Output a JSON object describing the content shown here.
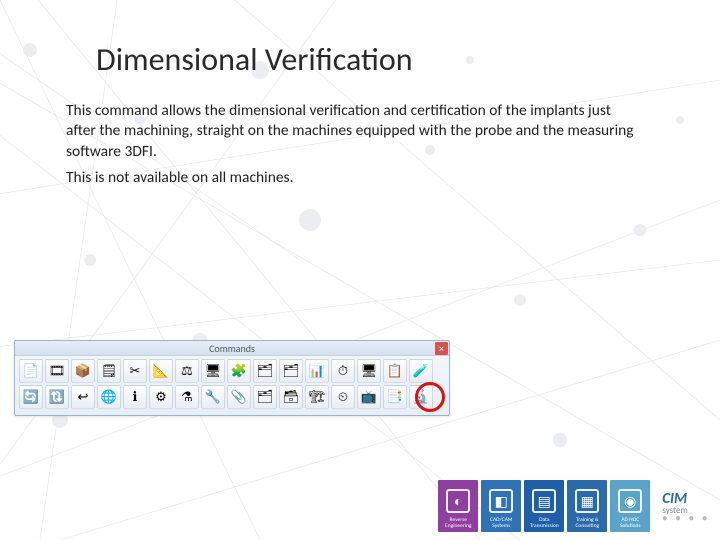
{
  "title": "Dimensional Verification",
  "para1": "This command allows the dimensional verification and certification of the implants just after the machining, straight on the machines equipped with the probe and the measuring software 3DFI.",
  "para2": "This is not available on all machines.",
  "toolbar": {
    "title": "Commands",
    "close": "×",
    "row1": [
      "📄",
      "🎞",
      "📦",
      "🗒",
      "✂",
      "📐",
      "⚖",
      "🖥",
      "🧩",
      "🗂",
      "🗂",
      "📊",
      "⏱",
      "🖥",
      "📋",
      "🧪"
    ],
    "row2": [
      "🔄",
      "🔃",
      "↩",
      "🌐",
      "ℹ",
      "⚙",
      "⚗",
      "🔧",
      "📎",
      "🗂",
      "🗃",
      "🏗",
      "⏲",
      "📺",
      "📑",
      "🔬"
    ]
  },
  "footer": {
    "tiles": [
      {
        "label": "Reverse Engineering",
        "color": "#8e3fa0",
        "glyph": "◐"
      },
      {
        "label": "CAD/CAM Systems",
        "color": "#2f72b6",
        "glyph": "◧"
      },
      {
        "label": "Data Transmission",
        "color": "#1f5fa8",
        "glyph": "▤"
      },
      {
        "label": "Training & Consulting",
        "color": "#2a6aa8",
        "glyph": "▦"
      },
      {
        "label": "AD HOC Solutions",
        "color": "#5aa3c9",
        "glyph": "◉"
      }
    ],
    "logo": "CIM",
    "logo_sub": "system"
  }
}
